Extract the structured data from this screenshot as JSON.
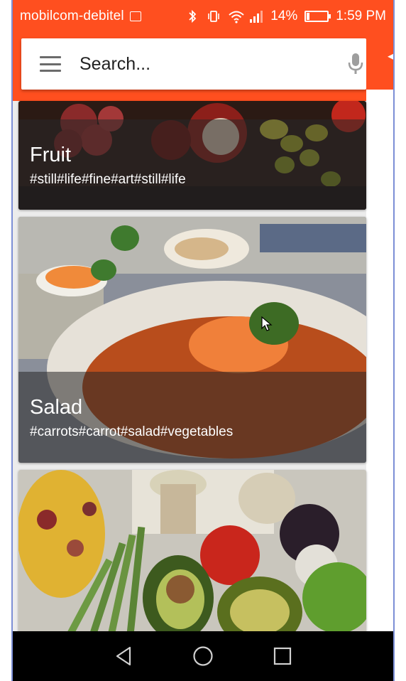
{
  "status_bar": {
    "carrier": "mobilcom-debitel",
    "battery_text": "14%",
    "battery_level": 0.14,
    "time": "1:59 PM"
  },
  "search": {
    "placeholder": "Search...",
    "menu_icon": "hamburger-menu-icon",
    "mic_icon": "microphone-icon"
  },
  "cards": [
    {
      "title": "Fruit",
      "tags": "#still#life#fine#art#still#life"
    },
    {
      "title": "Salad",
      "tags": "#carrots#carrot#salad#vegetables"
    },
    {
      "title": "",
      "tags": ""
    }
  ],
  "nav": {
    "back_icon": "back-triangle-icon",
    "home_icon": "home-circle-icon",
    "recents_icon": "recents-square-icon"
  },
  "colors": {
    "accent": "#ff4f1f",
    "nav_bar": "#000000"
  }
}
